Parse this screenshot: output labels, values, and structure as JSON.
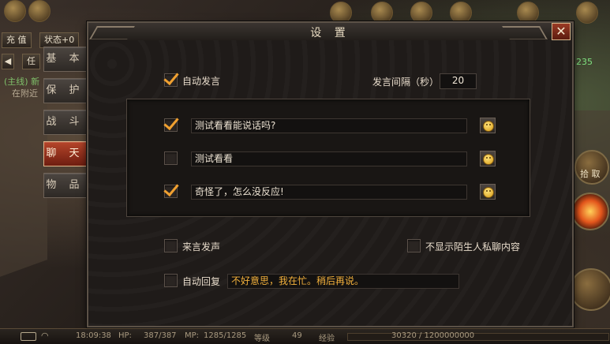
{
  "dialog": {
    "title": "设 置",
    "close_label": "✕"
  },
  "tabs": [
    {
      "label": "基 本",
      "active": false
    },
    {
      "label": "保 护",
      "active": false
    },
    {
      "label": "战 斗",
      "active": false
    },
    {
      "label": "聊 天",
      "active": true
    },
    {
      "label": "物 品",
      "active": false
    }
  ],
  "chat_settings": {
    "auto_speak": {
      "label": "自动发言",
      "checked": true
    },
    "interval": {
      "label": "发言间隔（秒）",
      "value": "20"
    },
    "messages": [
      {
        "checked": true,
        "text": "测试看看能说话吗?"
      },
      {
        "checked": false,
        "text": "测试看看"
      },
      {
        "checked": true,
        "text": "奇怪了，怎么没反应!"
      }
    ],
    "sound_on_message": {
      "label": "来言发声",
      "checked": false
    },
    "hide_stranger_pm": {
      "label": "不显示陌生人私聊内容",
      "checked": false
    },
    "auto_reply": {
      "label": "自动回复",
      "checked": false,
      "text": "不好意思，我在忙。稍后再说。"
    }
  },
  "hud": {
    "recharge": "充 值",
    "status": "状态+0",
    "quest_main": "(主线) 新",
    "quest_nearby": "在附近",
    "quest_task": "任",
    "pickup": "拾 取",
    "number_badge": "235"
  },
  "statusbar": {
    "time": "18:09:38",
    "hp_label": "HP:",
    "hp_value": "387/387",
    "mp_label": "MP:",
    "mp_value": "1285/1285",
    "level_label": "等级",
    "level_value": "49",
    "exp_label": "经验",
    "exp_value": "30320 / 1200000000",
    "exp_fraction": 2.53e-05
  }
}
